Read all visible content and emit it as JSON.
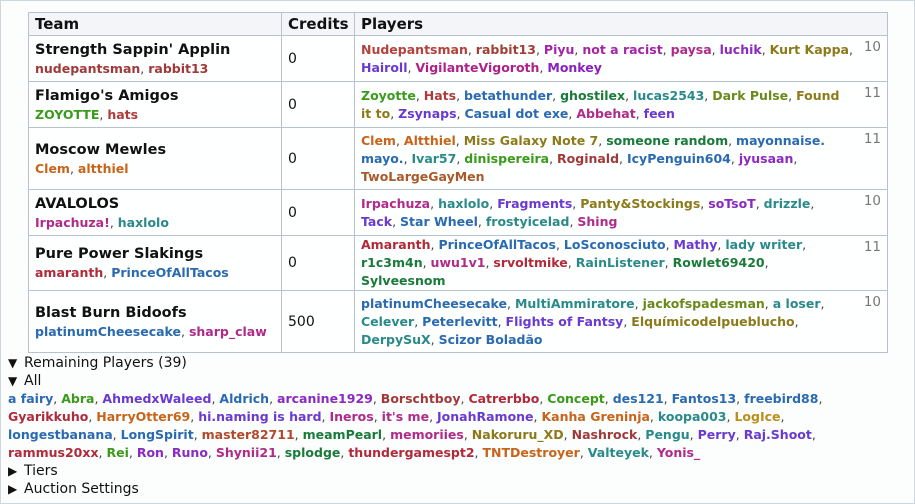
{
  "table": {
    "headers": [
      "Team",
      "Credits",
      "Players"
    ],
    "teams": [
      {
        "name": "Strength Sappin' Applin",
        "managers": [
          {
            "name": "nudepantsman",
            "color": "#a03a3a"
          },
          {
            "name": "rabbit13",
            "color": "#a03a3a"
          }
        ],
        "credits": "0",
        "players": [
          {
            "name": "Nudepantsman",
            "color": "#b5413d"
          },
          {
            "name": "rabbit13",
            "color": "#a04035"
          },
          {
            "name": "Piyu",
            "color": "#a524a8"
          },
          {
            "name": "not a racist",
            "color": "#a524a8"
          },
          {
            "name": "paysa",
            "color": "#b02a8a"
          },
          {
            "name": "luchik",
            "color": "#8a2ac0"
          },
          {
            "name": "Kurt Kappa",
            "color": "#8c7a1a"
          },
          {
            "name": "Hairoll",
            "color": "#6a3ad0"
          },
          {
            "name": "VigilanteVigoroth",
            "color": "#b0208a"
          },
          {
            "name": "Monkey",
            "color": "#8a20c0"
          }
        ],
        "count": "10"
      },
      {
        "name": "Flamigo's Amigos",
        "managers": [
          {
            "name": "ZOYOTTE",
            "color": "#3a9a1a"
          },
          {
            "name": "hats",
            "color": "#b03a3a"
          }
        ],
        "credits": "0",
        "players": [
          {
            "name": "Zoyotte",
            "color": "#3a9a1a"
          },
          {
            "name": "Hats",
            "color": "#b03a3a"
          },
          {
            "name": "betathunder",
            "color": "#2a6ab0"
          },
          {
            "name": "ghostilex",
            "color": "#1a7a3a"
          },
          {
            "name": "lucas2543",
            "color": "#2a8a8a"
          },
          {
            "name": "Dark Pulse",
            "color": "#6a8a1a"
          },
          {
            "name": "Found it to",
            "color": "#8c7a1a"
          },
          {
            "name": "Zsynaps",
            "color": "#6a3ad0"
          },
          {
            "name": "Casual dot exe",
            "color": "#2a6ab0"
          },
          {
            "name": "Abbehat",
            "color": "#b02a8a"
          },
          {
            "name": "feen",
            "color": "#6a3ad0"
          }
        ],
        "count": "11"
      },
      {
        "name": "Moscow Mewles",
        "managers": [
          {
            "name": "Clem",
            "color": "#c8641a"
          },
          {
            "name": "altthiel",
            "color": "#c8641a"
          }
        ],
        "credits": "0",
        "players": [
          {
            "name": "Clem",
            "color": "#c8641a"
          },
          {
            "name": "Altthiel",
            "color": "#c8641a"
          },
          {
            "name": "Miss Galaxy Note 7",
            "color": "#8c7a1a"
          },
          {
            "name": "someone random",
            "color": "#1a7a3a"
          },
          {
            "name": "mayonnaise. mayo.",
            "color": "#2a6ab0"
          },
          {
            "name": "Ivar57",
            "color": "#2a8a8a"
          },
          {
            "name": "dinispereira",
            "color": "#3a9a1a"
          },
          {
            "name": "Roginald",
            "color": "#a03a3a"
          },
          {
            "name": "IcyPenguin604",
            "color": "#2a6ab0"
          },
          {
            "name": "jyusaan",
            "color": "#8a2ac0"
          },
          {
            "name": "TwoLargeGayMen",
            "color": "#a85a2a"
          }
        ],
        "count": "11"
      },
      {
        "name": "AVALOLOS",
        "managers": [
          {
            "name": "Irpachuza!",
            "color": "#b02a8a"
          },
          {
            "name": "haxlolo",
            "color": "#2a8a8a"
          }
        ],
        "credits": "0",
        "players": [
          {
            "name": "Irpachuza",
            "color": "#b02a8a"
          },
          {
            "name": "haxlolo",
            "color": "#2a8a8a"
          },
          {
            "name": "Fragments",
            "color": "#6a3ad0"
          },
          {
            "name": "Panty&Stockings",
            "color": "#8c7a1a"
          },
          {
            "name": "soTsoT",
            "color": "#8a2ac0"
          },
          {
            "name": "drizzle",
            "color": "#2a8a8a"
          },
          {
            "name": "Tack",
            "color": "#6a3ad0"
          },
          {
            "name": "Star Wheel",
            "color": "#2a6ab0"
          },
          {
            "name": "frostyicelad",
            "color": "#2a8a8a"
          },
          {
            "name": "Shing",
            "color": "#b02a8a"
          }
        ],
        "count": "10"
      },
      {
        "name": "Pure Power Slakings",
        "managers": [
          {
            "name": "amaranth",
            "color": "#b02a3a"
          },
          {
            "name": "PrinceOfAllTacos",
            "color": "#2a6ab0"
          }
        ],
        "credits": "0",
        "players": [
          {
            "name": "Amaranth",
            "color": "#b02a3a"
          },
          {
            "name": "PrinceOfAllTacos",
            "color": "#2a6ab0"
          },
          {
            "name": "LoSconosciuto",
            "color": "#2a6ab0"
          },
          {
            "name": "Mathy",
            "color": "#6a3ad0"
          },
          {
            "name": "lady writer",
            "color": "#2a8a8a"
          },
          {
            "name": "r1c3m4n",
            "color": "#1a7a3a"
          },
          {
            "name": "uwu1v1",
            "color": "#b02a8a"
          },
          {
            "name": "srvoltmike",
            "color": "#b02a3a"
          },
          {
            "name": "RainListener",
            "color": "#2a8a8a"
          },
          {
            "name": "Rowlet69420",
            "color": "#1a7a3a"
          },
          {
            "name": "Sylveesnom",
            "color": "#1a7a3a"
          }
        ],
        "count": "11"
      },
      {
        "name": "Blast Burn Bidoofs",
        "managers": [
          {
            "name": "platinumCheesecake",
            "color": "#2a6ab0"
          },
          {
            "name": "sharp_claw",
            "color": "#b02a8a"
          }
        ],
        "credits": "500",
        "players": [
          {
            "name": "platinumCheesecake",
            "color": "#2a6ab0"
          },
          {
            "name": "MultiAmmiratore",
            "color": "#2a8a8a"
          },
          {
            "name": "jackofspadesman",
            "color": "#6a8a1a"
          },
          {
            "name": "a loser",
            "color": "#2a8a8a"
          },
          {
            "name": "Celever",
            "color": "#2a8a8a"
          },
          {
            "name": "Peterlevitt",
            "color": "#2a6ab0"
          },
          {
            "name": "Flights of Fantsy",
            "color": "#6a3ad0"
          },
          {
            "name": "Elquímicodelpueblucho",
            "color": "#8c7a1a"
          },
          {
            "name": "DerpySuX",
            "color": "#2a8a8a"
          },
          {
            "name": "Scizor Boladão",
            "color": "#2a6ab0"
          }
        ],
        "count": "10"
      }
    ]
  },
  "remaining": {
    "summary": "Remaining Players (39)",
    "all_label": "All",
    "players": [
      {
        "name": "a fairy",
        "color": "#2a6ab0"
      },
      {
        "name": "Abra",
        "color": "#3a9a1a"
      },
      {
        "name": "AhmedxWaleed",
        "color": "#6a3ad0"
      },
      {
        "name": "Aldrich",
        "color": "#2a6ab0"
      },
      {
        "name": "arcanine1929",
        "color": "#8a2ac0"
      },
      {
        "name": "Borschtboy",
        "color": "#a03a3a"
      },
      {
        "name": "Catrerbbo",
        "color": "#b02a3a"
      },
      {
        "name": "Concept",
        "color": "#3a9a1a"
      },
      {
        "name": "des121",
        "color": "#2a6ab0"
      },
      {
        "name": "Fantos13",
        "color": "#2a6ab0"
      },
      {
        "name": "freebird88",
        "color": "#2a6ab0"
      },
      {
        "name": "Gyarikkuho",
        "color": "#b02a3a"
      },
      {
        "name": "HarryOtter69",
        "color": "#c8641a"
      },
      {
        "name": "hi.naming is hard",
        "color": "#6a3ad0"
      },
      {
        "name": "Ineros",
        "color": "#b02a8a"
      },
      {
        "name": "it's me",
        "color": "#b02a8a"
      },
      {
        "name": "JonahRamone",
        "color": "#6a3ad0"
      },
      {
        "name": "Kanha Greninja",
        "color": "#c8641a"
      },
      {
        "name": "koopa003",
        "color": "#2a8a8a"
      },
      {
        "name": "LogIce",
        "color": "#b8901a"
      },
      {
        "name": "longestbanana",
        "color": "#2a6ab0"
      },
      {
        "name": "LongSpirit",
        "color": "#2a6ab0"
      },
      {
        "name": "master82711",
        "color": "#b04a2a"
      },
      {
        "name": "meamPearl",
        "color": "#1a7a3a"
      },
      {
        "name": "memoriies",
        "color": "#b02a8a"
      },
      {
        "name": "Nakoruru_XD",
        "color": "#8c7a1a"
      },
      {
        "name": "Nashrock",
        "color": "#a03a3a"
      },
      {
        "name": "Pengu",
        "color": "#2a8a8a"
      },
      {
        "name": "Perry",
        "color": "#6a3ad0"
      },
      {
        "name": "Raj.Shoot",
        "color": "#6a3ad0"
      },
      {
        "name": "rammus20xx",
        "color": "#b02a3a"
      },
      {
        "name": "Rei",
        "color": "#3a9a1a"
      },
      {
        "name": "Ron",
        "color": "#8a2ac0"
      },
      {
        "name": "Runo",
        "color": "#8a2ac0"
      },
      {
        "name": "Shynii21",
        "color": "#b02a8a"
      },
      {
        "name": "splodge",
        "color": "#1a7a3a"
      },
      {
        "name": "thundergamespt2",
        "color": "#b02a3a"
      },
      {
        "name": "TNTDestroyer",
        "color": "#c8641a"
      },
      {
        "name": "Valteyek",
        "color": "#2a8a8a"
      },
      {
        "name": "Yonis_",
        "color": "#b02a8a"
      }
    ]
  },
  "tiers": {
    "summary": "Tiers"
  },
  "settings": {
    "summary": "Auction Settings"
  },
  "glyphs": {
    "expanded": "▼",
    "collapsed": "▶",
    "sep": ", "
  }
}
